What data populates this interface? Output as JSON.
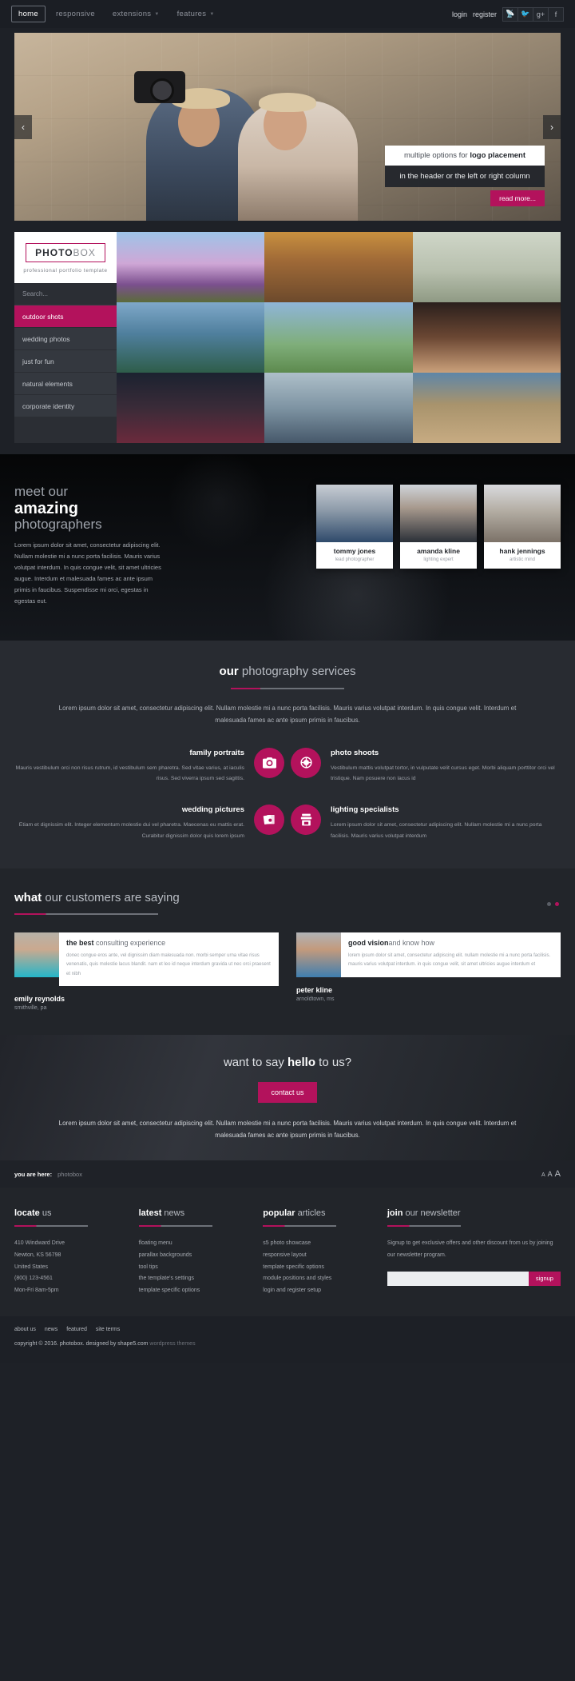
{
  "nav": {
    "items": [
      {
        "label": "home",
        "active": true,
        "caret": false
      },
      {
        "label": "responsive",
        "active": false,
        "caret": false
      },
      {
        "label": "extensions",
        "active": false,
        "caret": true
      },
      {
        "label": "features",
        "active": false,
        "caret": true
      }
    ],
    "login": "login",
    "register": "register",
    "socials": [
      {
        "name": "rss-icon",
        "glyph": "ш"
      },
      {
        "name": "twitter-icon",
        "glyph": "ᵗ"
      },
      {
        "name": "googleplus-icon",
        "glyph": "g+"
      },
      {
        "name": "facebook-icon",
        "glyph": "f"
      }
    ]
  },
  "hero": {
    "caption_top_plain": "multiple options for ",
    "caption_top_bold": "logo placement",
    "caption_bottom": "in the header or the left or right column",
    "read_more": "read more...",
    "prev": "‹",
    "next": "›"
  },
  "portfolio": {
    "logo_part1": "PHOTO",
    "logo_part2": "BOX",
    "tagline": "professional portfolio template",
    "search_placeholder": "Search...",
    "categories": [
      {
        "label": "outdoor shots",
        "active": true
      },
      {
        "label": "wedding photos",
        "active": false
      },
      {
        "label": "just for fun",
        "active": false
      },
      {
        "label": "natural elements",
        "active": false
      },
      {
        "label": "corporate identity",
        "active": false
      }
    ]
  },
  "photographers": {
    "heading_line1": "meet our",
    "heading_line2": "amazing",
    "heading_line3": "photographers",
    "paragraph": "Lorem ipsum dolor sit amet, consectetur adipiscing elit. Nullam molestie mi a nunc porta facilisis. Mauris varius volutpat interdum. In quis congue velit, sit amet ultricies augue. Interdum et malesuada fames ac ante ipsum primis in faucibus. Suspendisse mi orci, egestas in egestas eut.",
    "cards": [
      {
        "name": "tommy jones",
        "role": "lead photographer"
      },
      {
        "name": "amanda kline",
        "role": "lighting expert"
      },
      {
        "name": "hank jennings",
        "role": "artistic mind"
      }
    ]
  },
  "services": {
    "title_bold": "our",
    "title_rest": " photography services",
    "lead": "Lorem ipsum dolor sit amet, consectetur adipiscing elit. Nullam molestie mi a nunc porta facilisis. Mauris varius volutpat interdum. In quis congue velit. Interdum et malesuada fames ac ante ipsum primis in faucibus.",
    "items": [
      {
        "title": "family portraits",
        "text": "Mauris vestibulum orci non risus rutrum, id vestibulum sem pharetra. Sed vitae varius, at iaculis risus. Sed viverra ipsum sed sagittis.",
        "icon": "camera-icon"
      },
      {
        "title": "photo shoots",
        "text": "Vestibulum mattis volutpat tortor, in vulputate velit cursus eget. Morbi aliquam porttitor orci vel tristique. Nam posuere non lacus id",
        "icon": "aperture-icon"
      },
      {
        "title": "wedding pictures",
        "text": "Etiam et dignissim elit. Integer elementum molestie dui vel pharetra. Maecenas eu mattis erat. Curabitur dignissim dolor quis lorem ipsum",
        "icon": "photos-icon"
      },
      {
        "title": "lighting specialists",
        "text": "Lorem ipsum dolor sit amet, consectetur adipiscing elit. Nullam molestie mi a nunc porta facilisis. Mauris varius volutpat interdum",
        "icon": "lightbox-icon"
      }
    ]
  },
  "testimonials": {
    "title_bold": "what",
    "title_rest": " our customers are saying",
    "items": [
      {
        "heading_bold": "the best",
        "heading_rest": " consulting experience",
        "text": "donec congue eros ante, vel dignissim diam malesuada non. morbi semper urna vitae risus venenatis, quis molestie lacus blandit. nam et leo id neque interdum gravida ut nec orci praesent et nibh",
        "name": "emily reynolds",
        "location": "smithville, pa"
      },
      {
        "heading_bold": "good vision",
        "heading_rest": "and know how",
        "text": "lorem ipsum dolor sit amet, consectetur adipiscing elit. nullam molestie mi a nunc porta facilisis. mauris varius volutpat interdum. in quis congue velit, sit amet ultricies augue interdum et",
        "name": "peter kline",
        "location": "arnoldtown, ms"
      }
    ]
  },
  "cta": {
    "heading_pre": "want to say ",
    "heading_bold": "hello",
    "heading_post": " to us?",
    "button": "contact us",
    "paragraph": "Lorem ipsum dolor sit amet, consectetur adipiscing elit. Nullam molestie mi a nunc porta facilisis. Mauris varius volutpat interdum. In quis congue velit. Interdum et malesuada fames ac ante ipsum primis in faucibus."
  },
  "breadcrumb": {
    "label": "you are here:",
    "value": "photobox",
    "font_small": "A",
    "font_medium": "A",
    "font_large": "A"
  },
  "footer": {
    "locate": {
      "title_bold": "locate",
      "title_rest": " us",
      "lines": [
        "410 Windward Drive",
        "Newton, KS 56798",
        "United States",
        "(800) 123-4561",
        "Mon-Fri 8am-5pm"
      ]
    },
    "news": {
      "title_bold": "latest",
      "title_rest": " news",
      "links": [
        "floating menu",
        "parallax backgrounds",
        "tool tips",
        "the template's settings",
        "template specific options"
      ]
    },
    "articles": {
      "title_bold": "popular",
      "title_rest": " articles",
      "links": [
        "s5 photo showcase",
        "responsive layout",
        "template specific options",
        "module positions and styles",
        "login and register setup"
      ]
    },
    "newsletter": {
      "title_bold": "join",
      "title_rest": " our newsletter",
      "paragraph": "Signup to get exclusive offers and other discount from us by joining our newsletter program.",
      "input_value": "",
      "button": "signup"
    }
  },
  "bottom": {
    "links": [
      "about us",
      "news",
      "featured",
      "site terms"
    ],
    "copyright": "copyright © 2016. photobox. designed by shape5.com",
    "copyright_muted": " wordpress themes"
  },
  "colors": {
    "accent": "#b3125c",
    "bg": "#22252a",
    "bg_dark": "#1b1e24"
  }
}
